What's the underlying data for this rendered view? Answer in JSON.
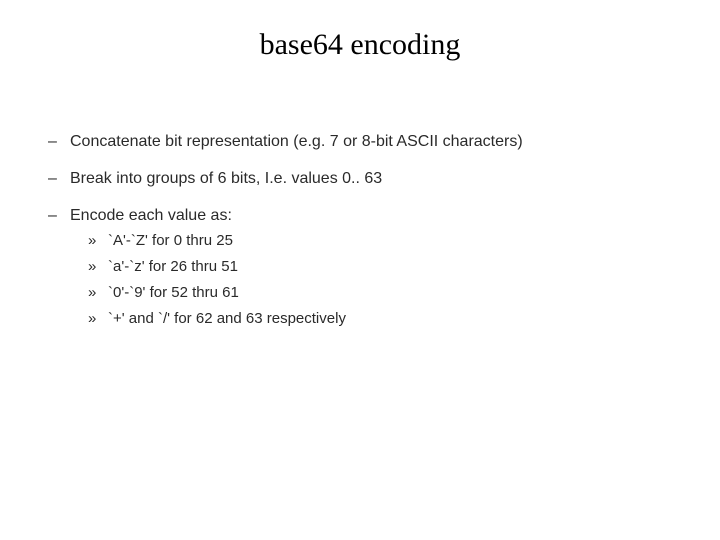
{
  "title": "base64 encoding",
  "bullets": [
    {
      "text": "Concatenate bit representation (e.g. 7 or 8-bit ASCII characters)"
    },
    {
      "text": "Break into groups of 6 bits, I.e. values 0.. 63"
    },
    {
      "text": "Encode each value as:"
    }
  ],
  "sub_bullets": [
    {
      "text": "`A'-`Z' for 0 thru 25"
    },
    {
      "text": "`a'-`z' for 26 thru 51"
    },
    {
      "text": "`0'-`9' for 52 thru 61"
    },
    {
      "text": "`+' and `/' for 62 and 63 respectively"
    }
  ],
  "markers": {
    "dash": "–",
    "raquo": "»"
  }
}
